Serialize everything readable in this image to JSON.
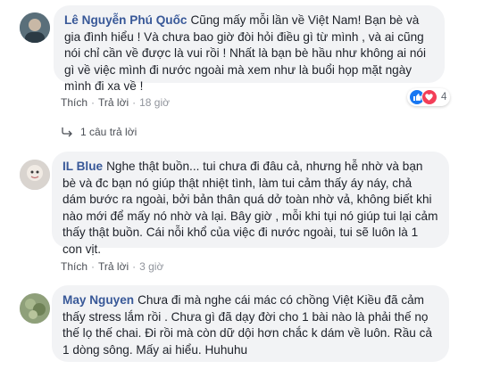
{
  "comments": [
    {
      "author": "Lê Nguyễn Phú Quốc",
      "text": "Cũng mấy mỗi lần về Việt Nam! Bạn bè và gia đình hiểu ! Và chưa bao giờ đòi hỏi điều gì từ mình , và ai cũng nói chỉ cần về được là vui rồi ! Nhất là bạn bè hầu như không ai nói gì về việc mình đi nước ngoài mà xem như là buổi họp mặt ngày mình đi xa về !",
      "like_label": "Thích",
      "reply_label": "Trả lời",
      "time": "18 giờ",
      "reaction_count": "4",
      "replies_label": "1 câu trả lời"
    },
    {
      "author": "IL Blue",
      "text": "Nghe thật buồn... tui chưa đi đâu cả, nhưng hễ nhờ và bạn bè và đc bạn nó giúp thật nhiệt tình, làm tui cảm thấy áy náy, chả dám bước ra ngoài, bởi bản thân quá dở toàn nhờ vả, không biết khi nào mới để mấy nó nhờ và lại. Bây giờ , mỗi khi tụi nó giúp tui lại cảm thấy thật buồn. Cái nỗi khổ của việc đi nước ngoài, tui sẽ luôn là 1 con vịt.",
      "like_label": "Thích",
      "reply_label": "Trả lời",
      "time": "3 giờ"
    },
    {
      "author": "May Nguyen",
      "text": "Chưa đi mà nghe cái mác có chồng Việt Kiều đã cảm thấy stress lắm rồi . Chưa gì đã dạy đời cho 1 bài nào là phải thế nọ thế lọ thế chai. Đi rồi mà còn dữ dội hơn chắc k dám về luôn. Rầu cả 1 dòng sông. Mấy ai hiểu. Huhuhu"
    }
  ],
  "colors": {
    "author": "#385898",
    "bubble": "#f2f3f5",
    "like": "#1877f2",
    "love": "#f33e58"
  },
  "icons": {
    "reply_arrow": "reply-arrow-icon",
    "like": "like-icon",
    "love": "love-icon"
  }
}
